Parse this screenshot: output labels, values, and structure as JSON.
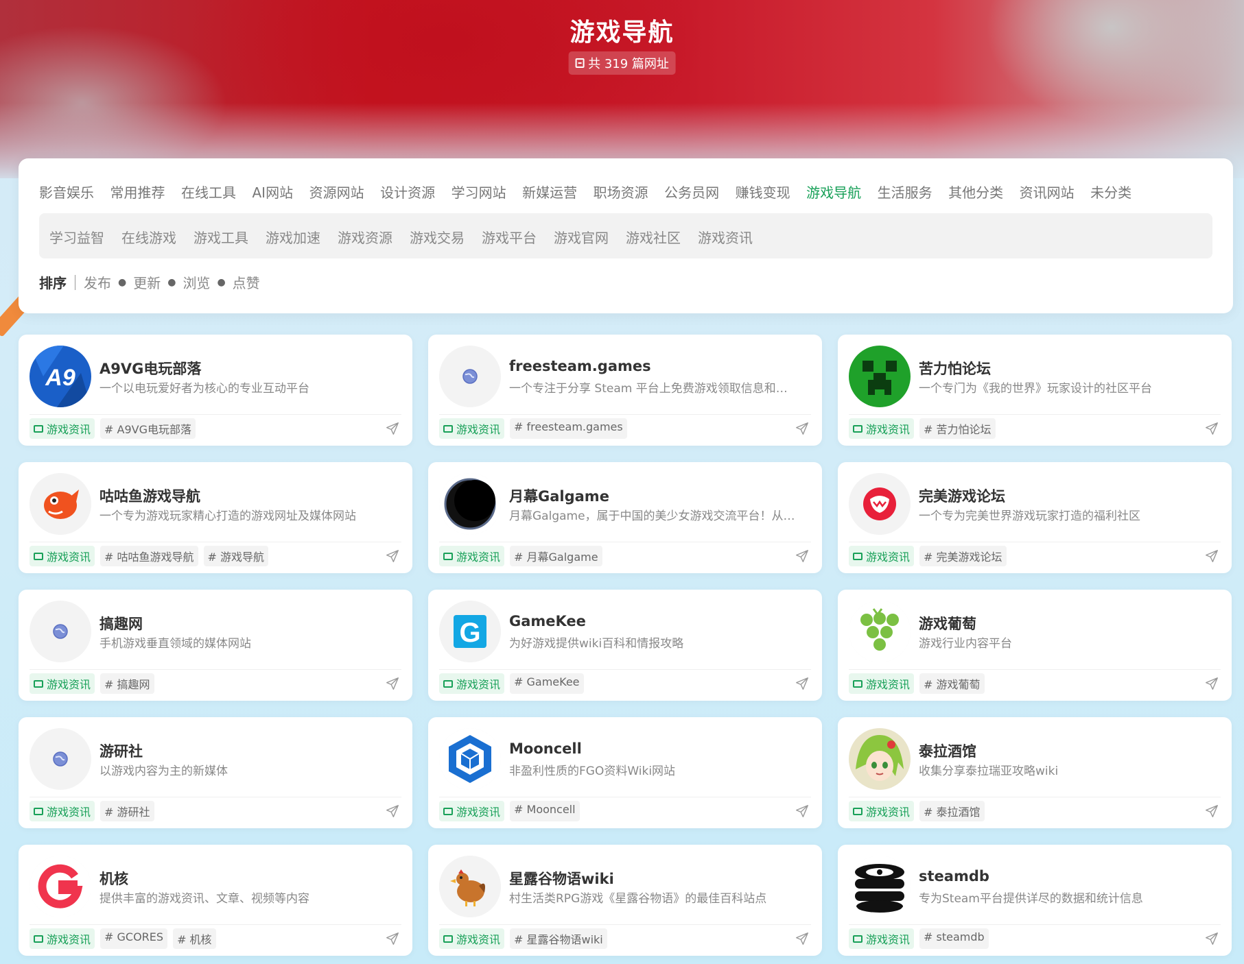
{
  "hero": {
    "title": "游戏导航",
    "count_text": "共 319 篇网址"
  },
  "categories": [
    "影音娱乐",
    "常用推荐",
    "在线工具",
    "AI网站",
    "资源网站",
    "设计资源",
    "学习网站",
    "新媒运营",
    "职场资源",
    "公务员网",
    "赚钱变现",
    "游戏导航",
    "生活服务",
    "其他分类",
    "资讯网站",
    "未分类"
  ],
  "active_category": "游戏导航",
  "subcategories": [
    "学习益智",
    "在线游戏",
    "游戏工具",
    "游戏加速",
    "游戏资源",
    "游戏交易",
    "游戏平台",
    "游戏官网",
    "游戏社区",
    "游戏资讯"
  ],
  "sort": {
    "label": "排序",
    "options": [
      "发布",
      "更新",
      "浏览",
      "点赞"
    ]
  },
  "colors": {
    "accent": "#18a058",
    "hero_red": "#c4141f"
  },
  "cards": [
    {
      "title": "A9VG电玩部落",
      "desc": "一个以电玩爱好者为核心的专业互动平台",
      "category": "游戏资讯",
      "tags": [
        "# A9VG电玩部落"
      ],
      "logo": "a9vg-logo"
    },
    {
      "title": "freesteam.games",
      "desc": "一个专注于分享 Steam 平台上免费游戏领取信息和…",
      "category": "游戏资讯",
      "tags": [
        "# freesteam.games"
      ],
      "logo": "globe-icon"
    },
    {
      "title": "苦力怕论坛",
      "desc": "一个专门为《我的世界》玩家设计的社区平台",
      "category": "游戏资讯",
      "tags": [
        "# 苦力怕论坛"
      ],
      "logo": "creeper-logo"
    },
    {
      "title": "咕咕鱼游戏导航",
      "desc": "一个专为游戏玩家精心打造的游戏网址及媒体网站",
      "category": "游戏资讯",
      "tags": [
        "# 咕咕鱼游戏导航",
        "# 游戏导航"
      ],
      "logo": "fish-logo"
    },
    {
      "title": "月幕Galgame",
      "desc": "月幕Galgame，属于中国的美少女游戏交流平台！从…",
      "category": "游戏资讯",
      "tags": [
        "# 月幕Galgame"
      ],
      "logo": "moon-logo"
    },
    {
      "title": "完美游戏论坛",
      "desc": "一个专为完美世界游戏玩家打造的福利社区",
      "category": "游戏资讯",
      "tags": [
        "# 完美游戏论坛"
      ],
      "logo": "wanmei-logo"
    },
    {
      "title": "搞趣网",
      "desc": "手机游戏垂直领域的媒体网站",
      "category": "游戏资讯",
      "tags": [
        "# 搞趣网"
      ],
      "logo": "globe-icon"
    },
    {
      "title": "GameKee",
      "desc": "为好游戏提供wiki百科和情报攻略",
      "category": "游戏资讯",
      "tags": [
        "# GameKee"
      ],
      "logo": "gamekee-logo"
    },
    {
      "title": "游戏葡萄",
      "desc": "游戏行业内容平台",
      "category": "游戏资讯",
      "tags": [
        "# 游戏葡萄"
      ],
      "logo": "grape-logo"
    },
    {
      "title": "游研社",
      "desc": "以游戏内容为主的新媒体",
      "category": "游戏资讯",
      "tags": [
        "# 游研社"
      ],
      "logo": "globe-icon"
    },
    {
      "title": "Mooncell",
      "desc": "非盈利性质的FGO资料Wiki网站",
      "category": "游戏资讯",
      "tags": [
        "# Mooncell"
      ],
      "logo": "mooncell-logo"
    },
    {
      "title": "泰拉酒馆",
      "desc": "收集分享泰拉瑞亚攻略wiki",
      "category": "游戏资讯",
      "tags": [
        "# 泰拉酒馆"
      ],
      "logo": "anime-avatar-logo"
    },
    {
      "title": "机核",
      "desc": "提供丰富的游戏资讯、文章、视频等内容",
      "category": "游戏资讯",
      "tags": [
        "# GCORES",
        "# 机核"
      ],
      "logo": "gcores-logo"
    },
    {
      "title": "星露谷物语wiki",
      "desc": "村生活类RPG游戏《星露谷物语》的最佳百科站点",
      "category": "游戏资讯",
      "tags": [
        "# 星露谷物语wiki"
      ],
      "logo": "chicken-logo"
    },
    {
      "title": "steamdb",
      "desc": "专为Steam平台提供详尽的数据和统计信息",
      "category": "游戏资讯",
      "tags": [
        "# steamdb"
      ],
      "logo": "steamdb-logo"
    }
  ]
}
